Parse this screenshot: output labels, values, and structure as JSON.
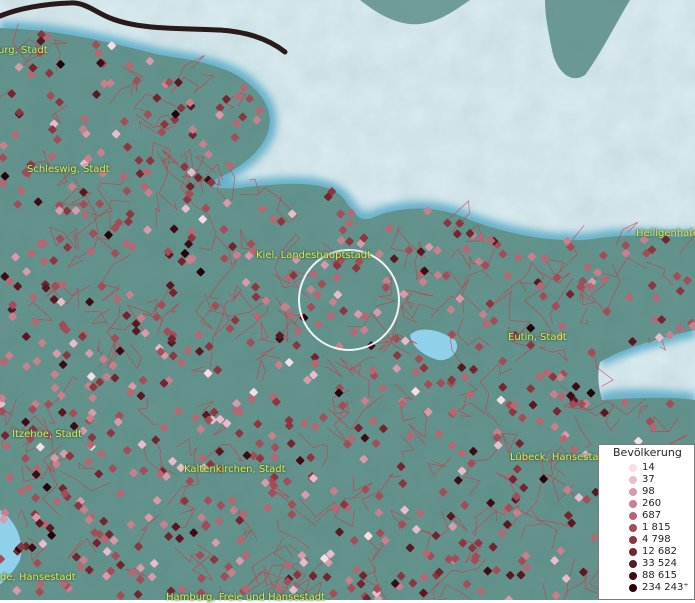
{
  "places": [
    {
      "label": "urg, Stadt"
    },
    {
      "label": "Schleswig, Stadt"
    },
    {
      "label": "Kiel, Landeshauptstadt"
    },
    {
      "label": "Heiligenhafen"
    },
    {
      "label": "Eutin, Stadt"
    },
    {
      "label": "Itzehoe, Stadt"
    },
    {
      "label": "Kaltenkirchen, Stadt"
    },
    {
      "label": "Lübeck, Hansestadt"
    },
    {
      "label": "de, Hansestadt"
    },
    {
      "label": "Hamburg, Freie und Hansestadt"
    }
  ],
  "legend": {
    "title": "Bevölkerung",
    "entries": [
      {
        "label": "14",
        "color": "#f6dde6"
      },
      {
        "label": "37",
        "color": "#e9bccb"
      },
      {
        "label": "98",
        "color": "#d99aa9"
      },
      {
        "label": "260",
        "color": "#c9808d"
      },
      {
        "label": "687",
        "color": "#b86671"
      },
      {
        "label": "1 815",
        "color": "#a44c57"
      },
      {
        "label": "4 798",
        "color": "#8e3640"
      },
      {
        "label": "12 682",
        "color": "#742530"
      },
      {
        "label": "33 524",
        "color": "#591822"
      },
      {
        "label": "88 615",
        "color": "#3d0d15"
      },
      {
        "label": "234 243⁺",
        "color": "#22040a"
      }
    ]
  },
  "colors": {
    "sea": "#dcecf2",
    "land": "#5e8f88",
    "coast_glow": "#5fb0cf",
    "boundary": "#d8313c",
    "label_text": "#e9e64a"
  }
}
